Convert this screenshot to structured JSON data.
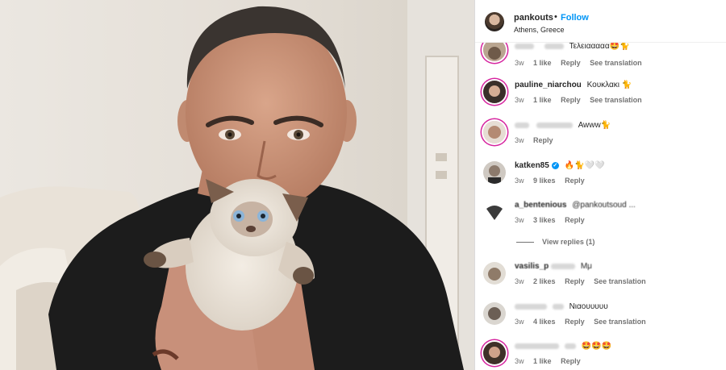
{
  "header": {
    "username": "pankouts",
    "separator": "•",
    "follow_label": "Follow",
    "location": "Athens, Greece"
  },
  "comments": [
    {
      "username": "",
      "text": "Τελειααααα🤩🐈",
      "time": "3w",
      "likes": "1 like",
      "reply": "Reply",
      "translate": "See translation"
    },
    {
      "username": "pauline_niarchou",
      "text": "Κουκλακι 🐈",
      "time": "3w",
      "likes": "1 like",
      "reply": "Reply",
      "translate": "See translation"
    },
    {
      "username": "",
      "text": "Awww🐈",
      "time": "3w",
      "likes": "",
      "reply": "Reply",
      "translate": ""
    },
    {
      "username": "katken85",
      "text": "🔥🐈🤍🤍",
      "time": "3w",
      "likes": "9 likes",
      "reply": "Reply",
      "translate": ""
    },
    {
      "username": "a_bentenious",
      "text": "@pankoutsoud ...",
      "time": "3w",
      "likes": "3 likes",
      "reply": "Reply",
      "translate": ""
    },
    {
      "username": "vasilis_p",
      "text": "Μμ",
      "time": "3w",
      "likes": "2 likes",
      "reply": "Reply",
      "translate": "See translation"
    },
    {
      "username": "",
      "text": "Νιαουυυυυ",
      "time": "3w",
      "likes": "4 likes",
      "reply": "Reply",
      "translate": "See translation"
    },
    {
      "username": "",
      "text": "🤩🤩🤩",
      "time": "3w",
      "likes": "1 like",
      "reply": "Reply",
      "translate": ""
    }
  ],
  "view_replies": "View replies (1)",
  "colors": {
    "follow": "#0095f6",
    "meta": "#737373",
    "story_ring": "#d6249f",
    "shirt": "#1c1c1c"
  }
}
